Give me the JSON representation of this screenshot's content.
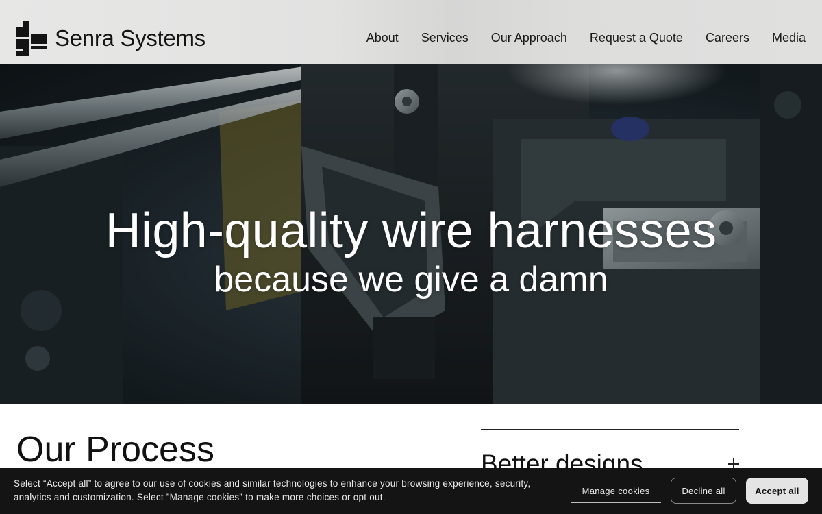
{
  "header": {
    "brand": "Senra Systems",
    "nav": [
      {
        "label": "About"
      },
      {
        "label": "Services"
      },
      {
        "label": "Our Approach"
      },
      {
        "label": "Request a Quote"
      },
      {
        "label": "Careers"
      },
      {
        "label": "Media"
      }
    ]
  },
  "hero": {
    "title": "High-quality wire harnesses",
    "subtitle": "because we give a damn",
    "background_icon": "machine-photo"
  },
  "process": {
    "title": "Our Process",
    "items": [
      {
        "label": "Better designs",
        "icon": "plus-icon"
      }
    ]
  },
  "cookie_banner": {
    "text": "Select “Accept all” to agree to our use of cookies and similar technologies to enhance your browsing experience, security, analytics and customization. Select ”Manage cookies” to make more choices or opt out.",
    "manage_label": "Manage cookies",
    "decline_label": "Decline all",
    "accept_label": "Accept all"
  },
  "colors": {
    "header_bg": "#e2e2e1",
    "banner_bg": "#141414",
    "accept_bg": "#e4e4e4",
    "text_dark": "#111111"
  }
}
